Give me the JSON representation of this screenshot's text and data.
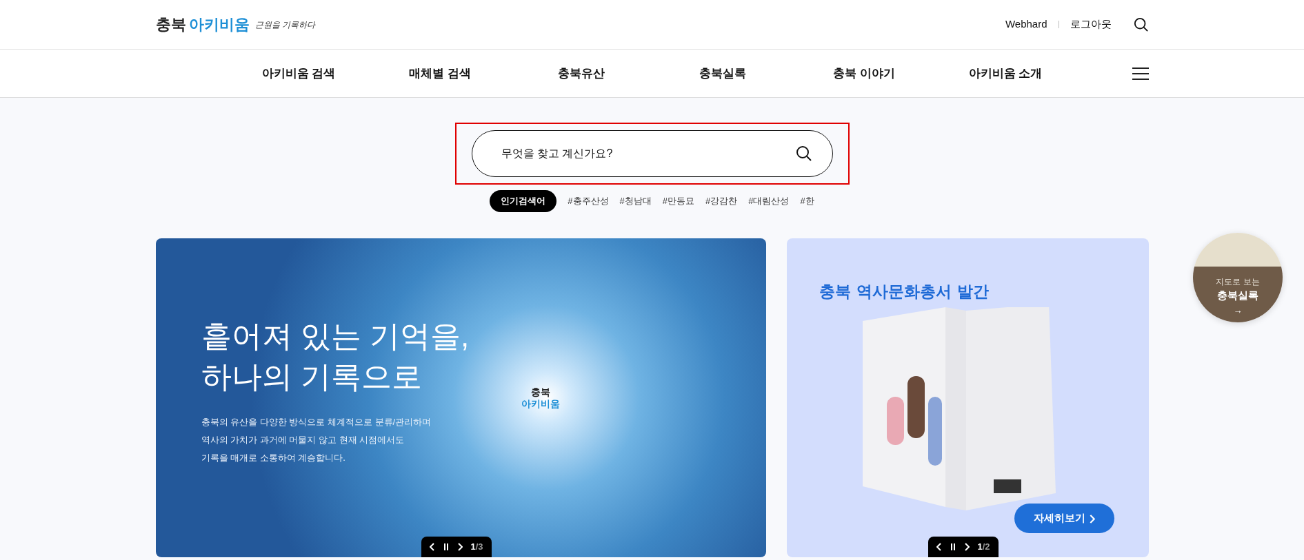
{
  "header": {
    "logo": {
      "primary": "충북",
      "secondary": "아키비움",
      "slogan": "근원을 기록하다"
    },
    "utility_links": [
      "Webhard",
      "로그아웃"
    ]
  },
  "nav": {
    "items": [
      "아키비움 검색",
      "매체별 검색",
      "충북유산",
      "충북실록",
      "충북 이야기",
      "아키비움 소개"
    ]
  },
  "search": {
    "placeholder": "무엇을 찾고 계신가요?",
    "popular_label": "인기검색어",
    "tags": [
      "#충주산성",
      "#청남대",
      "#만동묘",
      "#강감찬",
      "#대림산성",
      "#한"
    ]
  },
  "main_banner": {
    "headline": [
      "흩어져 있는 기억을,",
      "하나의 기록으로"
    ],
    "description": [
      "충북의 유산을 다양한 방식으로 체계적으로 분류/관리하며",
      "역사의 가치가 과거에 머물지 않고 현재 시점에서도",
      "기록을 매개로 소통하여 계승합니다."
    ],
    "center_logo": [
      "충북",
      "아키비움"
    ],
    "pager": {
      "current": "1",
      "separator": "/",
      "total": "3"
    }
  },
  "side_banner": {
    "title": "충북 역사문화총서 발간",
    "button": "자세히보기",
    "pager": {
      "current": "1",
      "separator": "/",
      "total": "2"
    }
  },
  "floating_link": {
    "caption": "지도로 보는",
    "title": "충북실록",
    "arrow": "→"
  }
}
